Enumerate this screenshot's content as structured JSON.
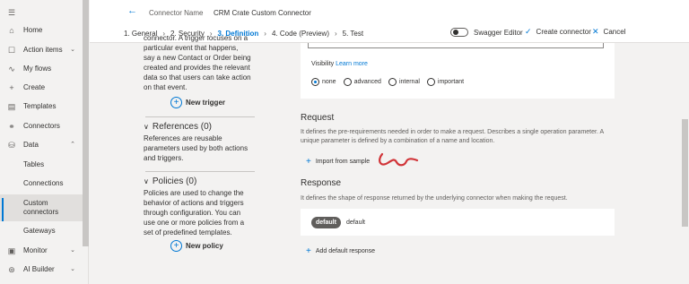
{
  "nav": {
    "items": [
      {
        "icon": "home-icon",
        "glyph": "⌂",
        "label": "Home"
      },
      {
        "icon": "action-items-icon",
        "glyph": "☐",
        "label": "Action items"
      },
      {
        "icon": "flows-icon",
        "glyph": "∿",
        "label": "My flows"
      },
      {
        "icon": "create-icon",
        "glyph": "+",
        "label": "Create"
      },
      {
        "icon": "templates-icon",
        "glyph": "▤",
        "label": "Templates"
      },
      {
        "icon": "connectors-icon",
        "glyph": "⚭",
        "label": "Connectors"
      },
      {
        "icon": "data-icon",
        "glyph": "⛁",
        "label": "Data"
      },
      {
        "label": "Tables"
      },
      {
        "label": "Connections"
      },
      {
        "label": "Custom connectors"
      },
      {
        "label": "Gateways"
      },
      {
        "icon": "monitor-icon",
        "glyph": "▣",
        "label": "Monitor"
      },
      {
        "icon": "ai-builder-icon",
        "glyph": "⊛",
        "label": "AI Builder"
      }
    ]
  },
  "header": {
    "connector_name_label": "Connector Name",
    "connector_name_value": "CRM Crate Custom Connector",
    "steps": [
      "1. General",
      "2. Security",
      "3. Definition",
      "4. Code (Preview)",
      "5. Test"
    ],
    "swagger_editor": "Swagger Editor",
    "create_connector": "Create connector",
    "cancel": "Cancel"
  },
  "left": {
    "trigger_desc_lines": [
      "connector. A trigger focuses on a",
      "particular event that happens,",
      "say a new Contact or Order being",
      "created and provides the relevant",
      "data so that users can take action",
      "on that event."
    ],
    "new_trigger": "New trigger",
    "references_title": "References (0)",
    "references_desc": "References are reusable parameters used by both actions and triggers.",
    "policies_title": "Policies (0)",
    "policies_desc": "Policies are used to change the behavior of actions and triggers through configuration. You can use one or more policies from a set of predefined templates.",
    "new_policy": "New policy"
  },
  "right": {
    "visibility_label": "Visibility",
    "learn_more": "Learn more",
    "visibility_options": [
      "none",
      "advanced",
      "internal",
      "important"
    ],
    "visibility_selected": "none",
    "request_title": "Request",
    "request_desc": "It defines the pre-requirements needed in order to make a request. Describes a single operation parameter. A unique parameter is defined by a combination of a name and location.",
    "import_from_sample": "Import from sample",
    "response_title": "Response",
    "response_desc": "It defines the shape of response returned by the underlying connector when making the request.",
    "default_badge": "default",
    "default_text": "default",
    "add_default_response": "Add default response"
  },
  "colors": {
    "accent": "#0078d4",
    "annotation": "#d13438"
  }
}
